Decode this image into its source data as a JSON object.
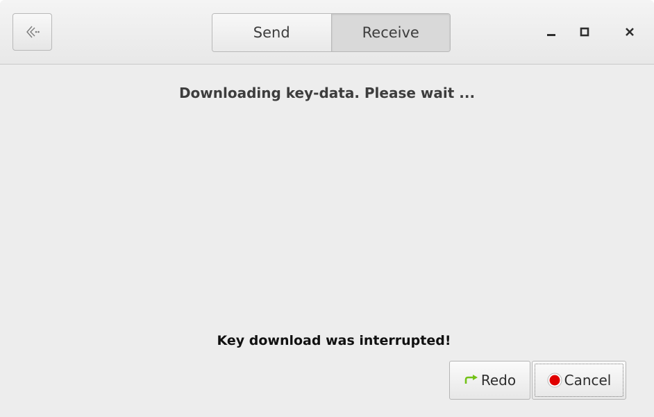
{
  "header": {
    "tabs": [
      {
        "label": "Send",
        "active": false
      },
      {
        "label": "Receive",
        "active": true
      }
    ],
    "back_icon": "back-arrows-icon",
    "window_controls": [
      "minimize-icon",
      "maximize-icon",
      "close-icon"
    ]
  },
  "main": {
    "title": "Downloading key-data. Please wait ...",
    "status": "Key download was interrupted!",
    "buttons": {
      "redo_label": "Redo",
      "redo_icon": "redo-arrow-icon",
      "cancel_label": "Cancel",
      "cancel_icon": "stop-icon"
    }
  },
  "colors": {
    "redo_icon": "#73c218",
    "cancel_icon": "#e00000",
    "background": "#ededed"
  }
}
